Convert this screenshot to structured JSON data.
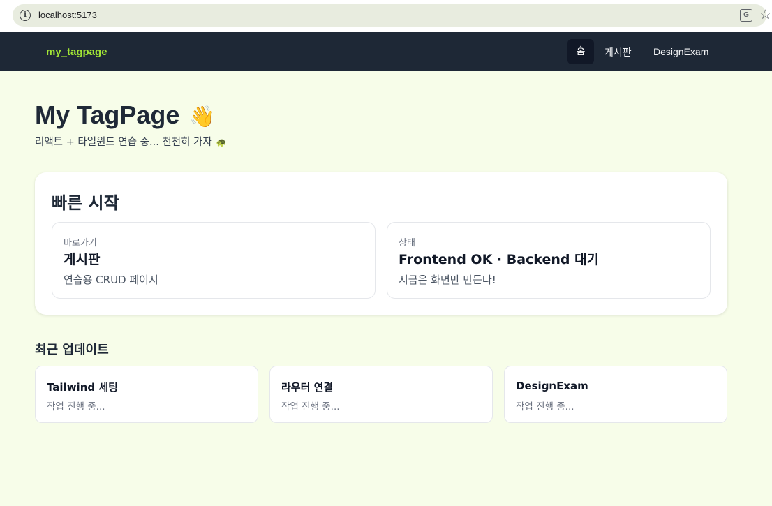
{
  "browser": {
    "url": "localhost:5173",
    "info_icon": "i",
    "translate_icon": "G",
    "star_icon": "☆"
  },
  "navbar": {
    "brand": "my_tagpage",
    "items": [
      {
        "label": "홈",
        "active": true
      },
      {
        "label": "게시판",
        "active": false
      },
      {
        "label": "DesignExam",
        "active": false
      }
    ]
  },
  "hero": {
    "title": "My TagPage",
    "wave_emoji": "👋",
    "subtitle": "리액트 + 타일윈드 연습 중... 천천히 가자",
    "turtle_emoji": "🐢"
  },
  "quick_start": {
    "title": "빠른 시작",
    "cards": [
      {
        "kicker": "바로가기",
        "title": "게시판",
        "desc": "연습용 CRUD 페이지"
      },
      {
        "kicker": "상태",
        "title": "Frontend OK · Backend 대기",
        "desc": "지금은 화면만 만든다!"
      }
    ]
  },
  "recent": {
    "heading": "최근 업데이트",
    "items": [
      {
        "title": "Tailwind 세팅",
        "status": "작업 진행 중..."
      },
      {
        "title": "라우터 연결",
        "status": "작업 진행 중..."
      },
      {
        "title": "DesignExam",
        "status": "작업 진행 중..."
      }
    ]
  },
  "colors": {
    "page_bg": "#f7fde9",
    "navbar_bg": "#1e2836",
    "brand": "#a3e635",
    "active_nav_bg": "#111827"
  }
}
